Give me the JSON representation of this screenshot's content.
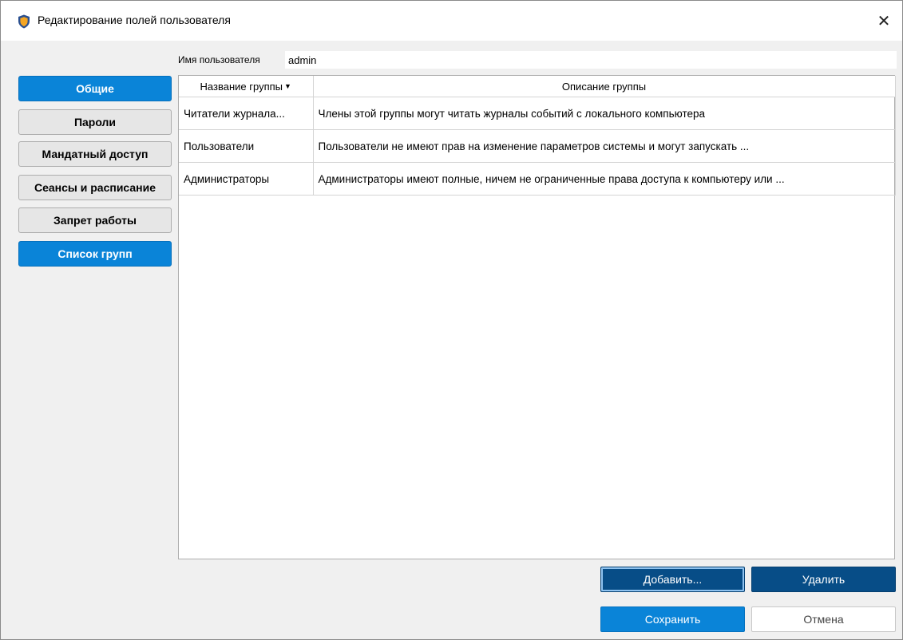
{
  "window": {
    "title": "Редактирование полей пользователя",
    "close_glyph": "✕",
    "icon": "shield-icon"
  },
  "user": {
    "label": "Имя пользователя",
    "value": "admin"
  },
  "sidebar": {
    "items": [
      {
        "label": "Общие",
        "active": true
      },
      {
        "label": "Пароли",
        "active": false
      },
      {
        "label": "Мандатный доступ",
        "active": false
      },
      {
        "label": "Сеансы и расписание",
        "active": false
      },
      {
        "label": "Запрет работы",
        "active": false
      },
      {
        "label": "Список групп",
        "active": true
      }
    ]
  },
  "table": {
    "columns": [
      {
        "label": "Название группы",
        "sort_glyph": "▼"
      },
      {
        "label": "Описание группы"
      }
    ],
    "rows": [
      {
        "name": "Читатели журнала...",
        "description": "Члены этой группы могут читать журналы событий с локального компьютера"
      },
      {
        "name": "Пользователи",
        "description": "Пользователи не имеют прав на изменение параметров системы и могут запускать ..."
      },
      {
        "name": "Администраторы",
        "description": "Администраторы имеют полные, ничем не ограниченные права доступа к компьютеру или ..."
      }
    ]
  },
  "buttons": {
    "add": "Добавить...",
    "remove": "Удалить",
    "save": "Сохранить",
    "cancel": "Отмена"
  },
  "colors": {
    "accent": "#0a84d8",
    "dark_accent": "#074d87",
    "background": "#f0f0f0"
  }
}
